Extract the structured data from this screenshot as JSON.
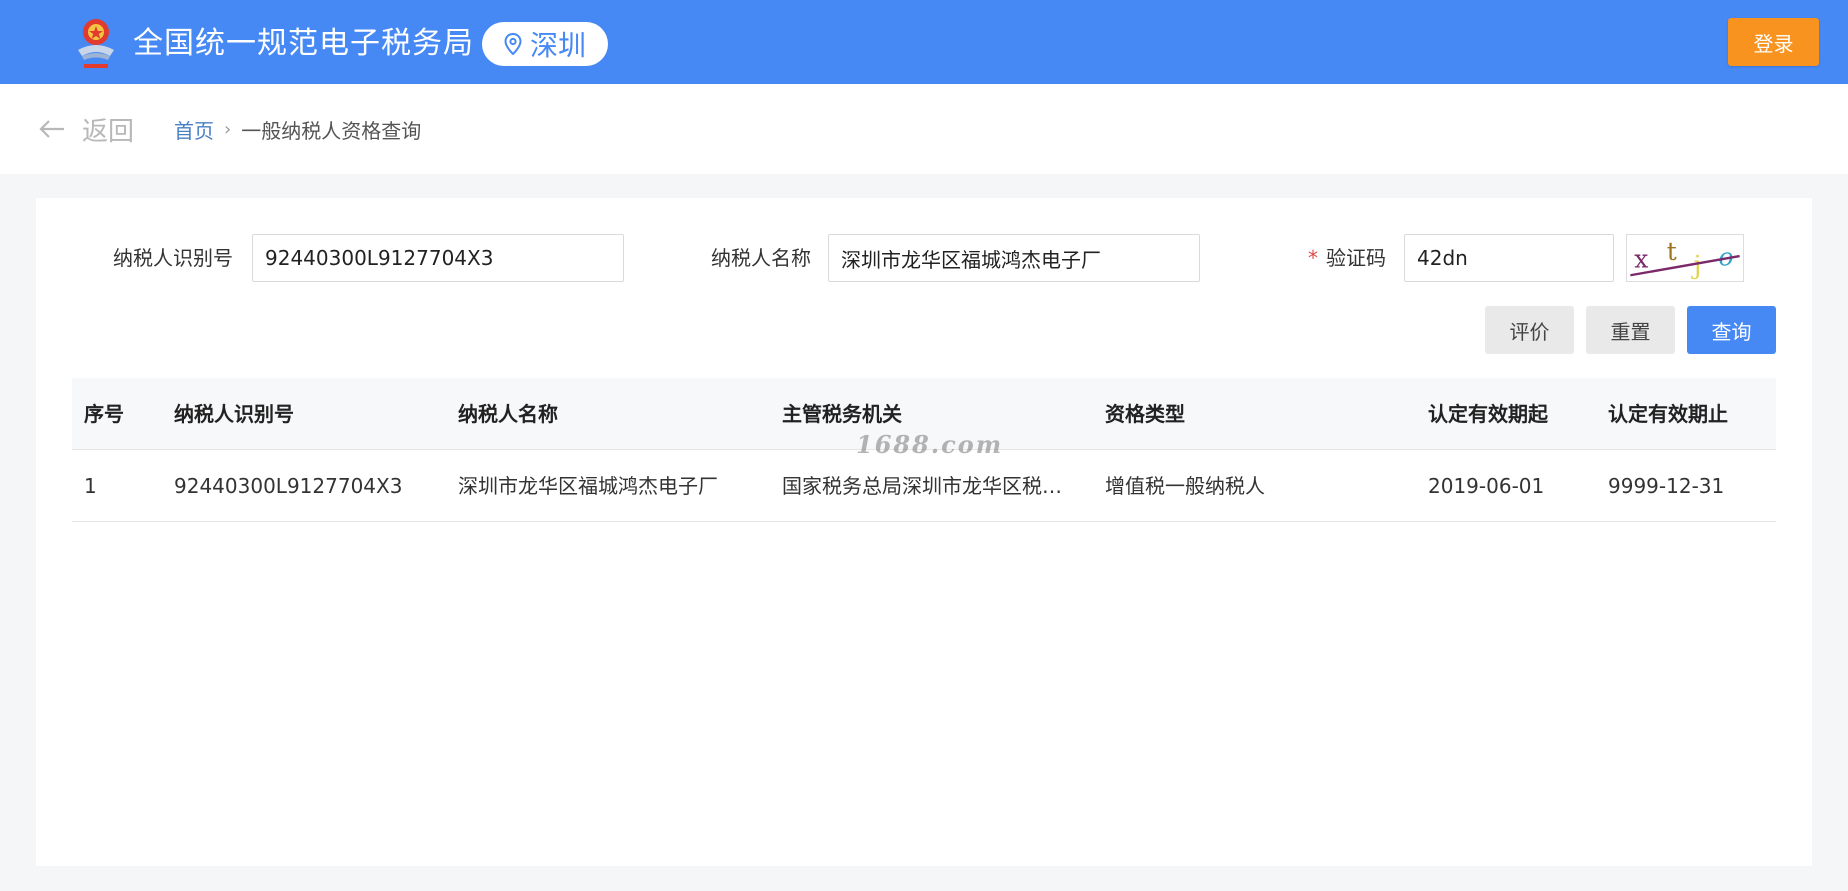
{
  "header": {
    "site_title": "全国统一规范电子税务局",
    "city": "深圳",
    "login_label": "登录",
    "brand_color": "#4689f5",
    "login_color": "#f7931e"
  },
  "subnav": {
    "back_label": "返回",
    "breadcrumb": {
      "home": "首页",
      "separator": "›",
      "current": "一般纳税人资格查询"
    }
  },
  "form": {
    "taxpayer_id_label": "纳税人识别号",
    "taxpayer_id_value": "92440300L9127704X3",
    "taxpayer_name_label": "纳税人名称",
    "taxpayer_name_value": "深圳市龙华区福城鸿杰电子厂",
    "captcha_required_mark": "*",
    "captcha_label": "验证码",
    "captcha_value": "42dn",
    "captcha_image_text": "xtjo"
  },
  "buttons": {
    "rate_label": "评价",
    "reset_label": "重置",
    "query_label": "查询"
  },
  "table": {
    "columns": [
      "序号",
      "纳税人识别号",
      "纳税人名称",
      "主管税务机关",
      "资格类型",
      "认定有效期起",
      "认定有效期止"
    ],
    "rows": [
      [
        "1",
        "92440300L9127704X3",
        "深圳市龙华区福城鸿杰电子厂",
        "国家税务总局深圳市龙华区税务局",
        "增值税一般纳税人",
        "2019-06-01",
        "9999-12-31"
      ]
    ]
  },
  "watermark": "1688.com"
}
